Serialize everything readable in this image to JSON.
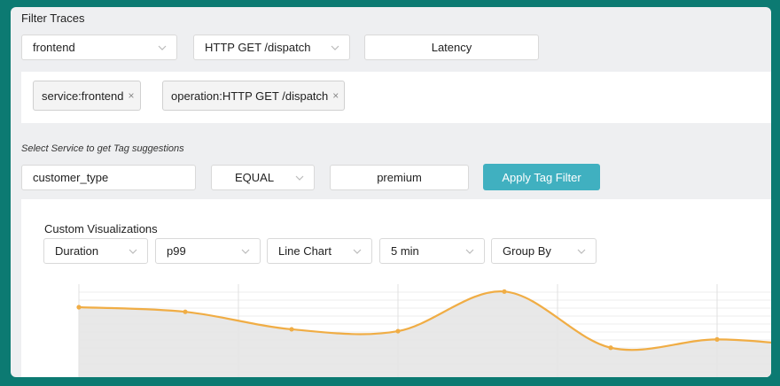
{
  "filter": {
    "title": "Filter Traces",
    "service": "frontend",
    "operation": "HTTP GET /dispatch",
    "latency_placeholder": "Latency"
  },
  "tags": [
    {
      "label": "service:frontend"
    },
    {
      "label": "operation:HTTP GET /dispatch"
    }
  ],
  "tag_filter": {
    "hint": "Select Service to get Tag suggestions",
    "key": "customer_type",
    "operator": "EQUAL",
    "value": "premium",
    "apply_label": "Apply Tag Filter",
    "apply_color": "#40b0c0"
  },
  "custom_viz": {
    "title": "Custom Visualizations",
    "metric": "Duration",
    "aggregation": "p99",
    "chart_type": "Line Chart",
    "interval": "5 min",
    "group_by": "Group By"
  },
  "chart_data": {
    "type": "area",
    "line_color": "#f0ad45",
    "fill_color": "#e6e6e6",
    "grid": true,
    "values": [
      0.75,
      0.7,
      0.51,
      0.49,
      0.92,
      0.31,
      0.4,
      0.31
    ]
  }
}
